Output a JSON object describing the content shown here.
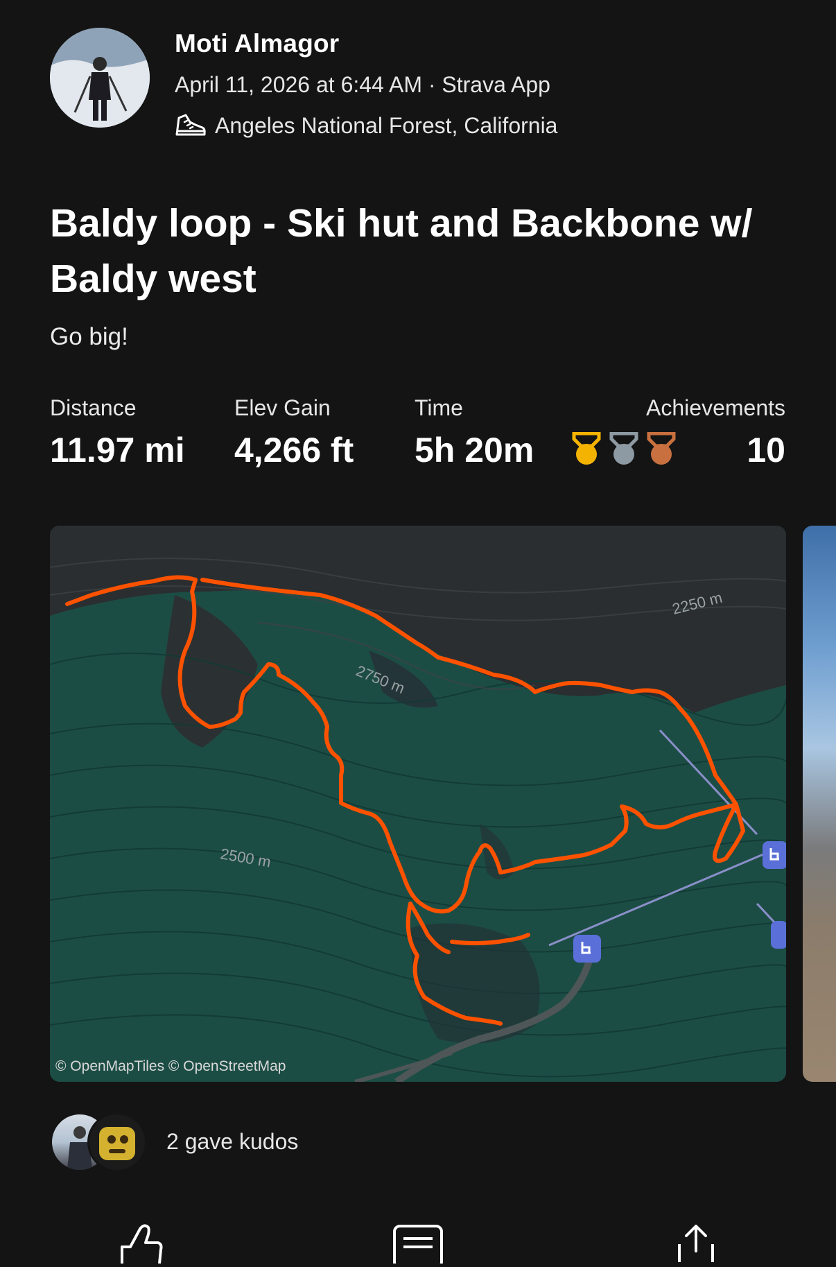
{
  "athlete": {
    "name": "Moti Almagor",
    "meta": "April 11, 2026 at 6:44 AM · Strava App",
    "location": "Angeles National Forest, California",
    "activity_icon": "hiking-shoe-icon"
  },
  "activity": {
    "title": "Baldy loop - Ski hut and Backbone w/ Baldy west",
    "description": "Go big!"
  },
  "stats": {
    "distance_label": "Distance",
    "distance_value": "11.97 mi",
    "elev_label": "Elev Gain",
    "elev_value": "4,266 ft",
    "time_label": "Time",
    "time_value": "5h 20m",
    "achievements_label": "Achievements",
    "achievements_value": "10",
    "medal_colors": {
      "gold": "#f5b301",
      "silver": "#8e9aa3",
      "bronze": "#c8703f"
    }
  },
  "map": {
    "contour_label_1": "2250 m",
    "contour_label_2": "2750 m",
    "contour_label_3": "2500 m",
    "attribution": "© OpenMapTiles © OpenStreetMap",
    "route_color": "#fc5200",
    "lift_icon": "chairlift-icon"
  },
  "kudos": {
    "text": "2 gave kudos"
  },
  "actions": [
    "kudos-thumb-icon",
    "comment-icon",
    "share-icon"
  ]
}
